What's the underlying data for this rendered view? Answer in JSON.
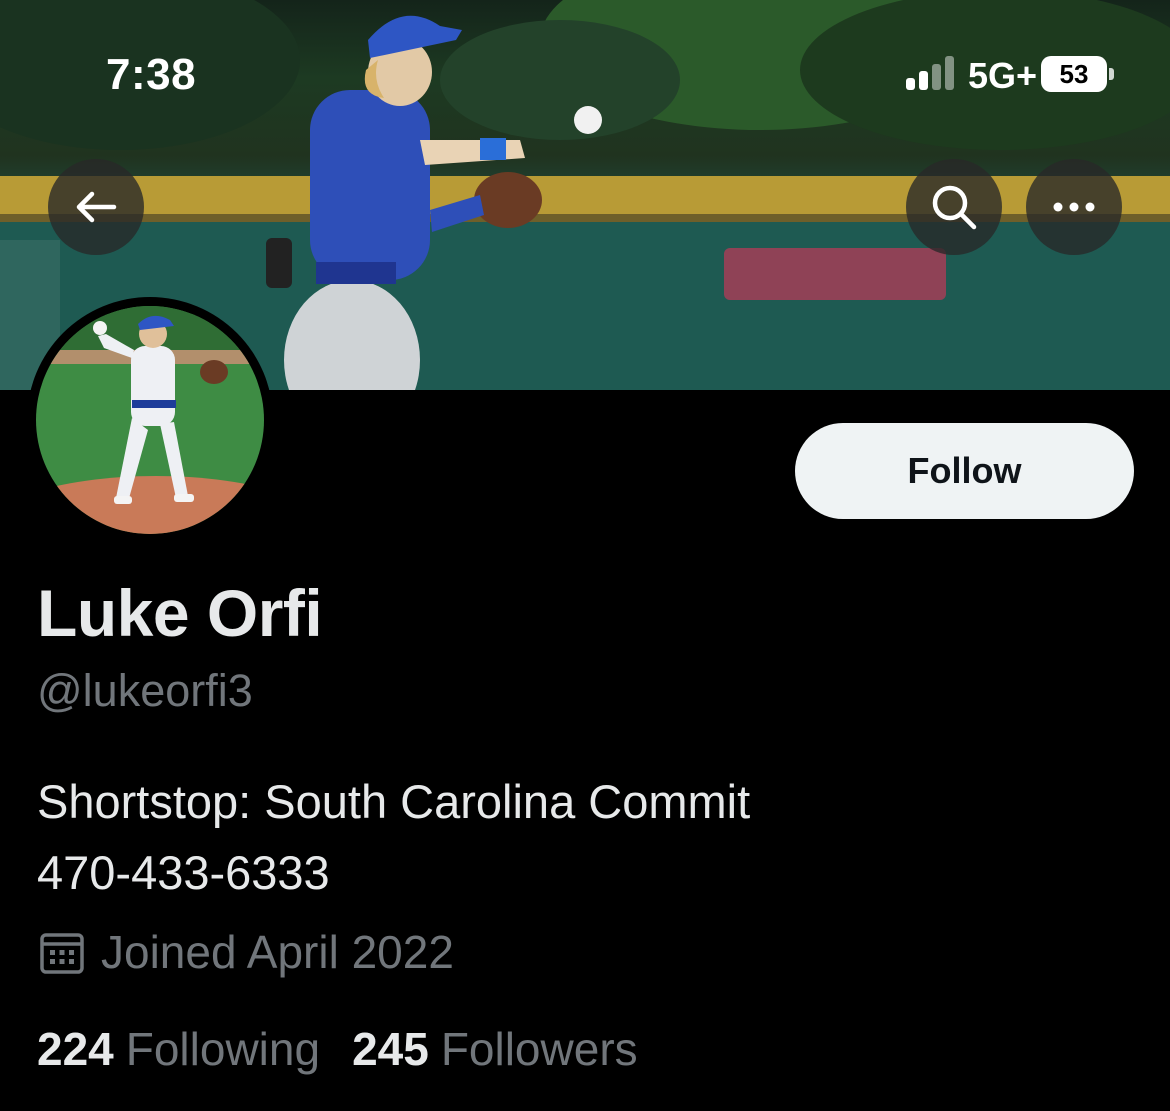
{
  "status_bar": {
    "time": "7:38",
    "network": "5G+",
    "battery": "53"
  },
  "header": {
    "back_icon": "arrow-left-icon",
    "search_icon": "search-icon",
    "more_icon": "more-horizontal-icon"
  },
  "profile": {
    "follow_label": "Follow",
    "name": "Luke Orfi",
    "handle": "@lukeorfi3",
    "bio_line1": "Shortstop: South Carolina Commit",
    "bio_line2": "470-433-6333",
    "joined_icon": "calendar-icon",
    "joined": "Joined April 2022",
    "following_count": "224",
    "following_label": "Following",
    "followers_count": "245",
    "followers_label": "Followers"
  },
  "colors": {
    "background": "#000000",
    "primary_text": "#e7e9ea",
    "secondary_text": "#71767b",
    "follow_button_bg": "#eff3f4"
  }
}
